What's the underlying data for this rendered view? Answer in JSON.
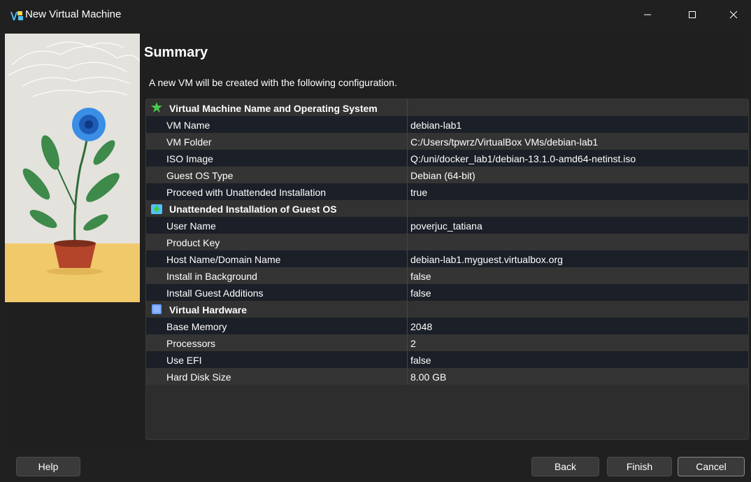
{
  "window": {
    "title": "New Virtual Machine",
    "app_icon": "virtualbox-icon",
    "controls": [
      "minimize-icon",
      "maximize-icon",
      "close-icon"
    ]
  },
  "page": {
    "heading": "Summary",
    "description": "A new VM will be created with the following configuration."
  },
  "summary": {
    "sections": [
      {
        "title": "Virtual Machine Name and Operating System",
        "icon": "star-icon",
        "icon_color": "#47c94b",
        "rows": [
          {
            "label": "VM Name",
            "value": "debian-lab1"
          },
          {
            "label": "VM Folder",
            "value": "C:/Users/tpwrz/VirtualBox VMs/debian-lab1"
          },
          {
            "label": "ISO Image",
            "value": "Q:/uni/docker_lab1/debian-13.1.0-amd64-netinst.iso"
          },
          {
            "label": "Guest OS Type",
            "value": "Debian (64-bit)"
          },
          {
            "label": "Proceed with Unattended Installation",
            "value": "true"
          }
        ]
      },
      {
        "title": "Unattended Installation of Guest OS",
        "icon": "install-package-icon",
        "icon_color": "#4fc3f7",
        "rows": [
          {
            "label": "User Name",
            "value": "poverjuc_tatiana"
          },
          {
            "label": "Product Key",
            "value": ""
          },
          {
            "label": "Host Name/Domain Name",
            "value": "debian-lab1.myguest.virtualbox.org"
          },
          {
            "label": "Install in Background",
            "value": "false"
          },
          {
            "label": "Install Guest Additions",
            "value": "false"
          }
        ]
      },
      {
        "title": "Virtual Hardware",
        "icon": "hardware-chip-icon",
        "icon_color": "#6b9eff",
        "rows": [
          {
            "label": "Base Memory",
            "value": "2048"
          },
          {
            "label": "Processors",
            "value": "2"
          },
          {
            "label": "Use EFI",
            "value": "false"
          },
          {
            "label": "Hard Disk Size",
            "value": "8.00 GB"
          }
        ]
      }
    ]
  },
  "buttons": {
    "help": "Help",
    "back": "Back",
    "finish": "Finish",
    "cancel": "Cancel"
  },
  "side_image": {
    "icon": "flower-pot-illustration"
  }
}
